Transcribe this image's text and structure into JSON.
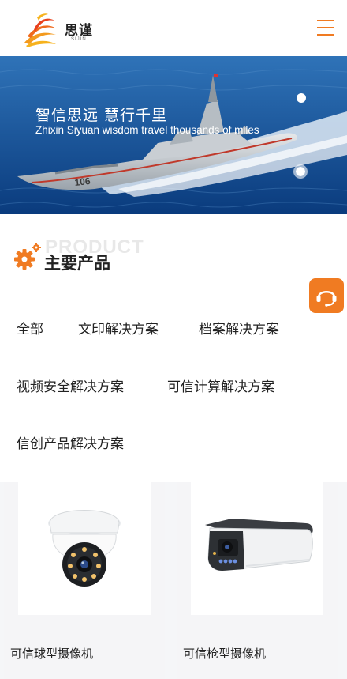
{
  "header": {
    "logo_text": "思谨",
    "logo_sub": "SIJIN",
    "menu_icon": "hamburger-menu-icon",
    "accent_color": "#f07b22"
  },
  "banner": {
    "title": "智信思远 慧行千里",
    "subtitle": "Zhixin Siyuan wisdom travel thousands of miles",
    "hull_number": "106",
    "slides": 2,
    "active_slide": 2
  },
  "section": {
    "bg_text": "PRODUCT",
    "title": "主要产品",
    "icon": "gear-icon"
  },
  "float": {
    "icon": "customer-service-headset-icon"
  },
  "categories": [
    {
      "label": "全部"
    },
    {
      "label": "文印解决方案"
    },
    {
      "label": "档案解决方案"
    },
    {
      "label": "视频安全解决方案"
    },
    {
      "label": "可信计算解决方案"
    },
    {
      "label": "信创产品解决方案"
    }
  ],
  "products": [
    {
      "name": "可信球型摄像机",
      "image": "dome-camera"
    },
    {
      "name": "可信枪型摄像机",
      "image": "bullet-camera"
    }
  ]
}
